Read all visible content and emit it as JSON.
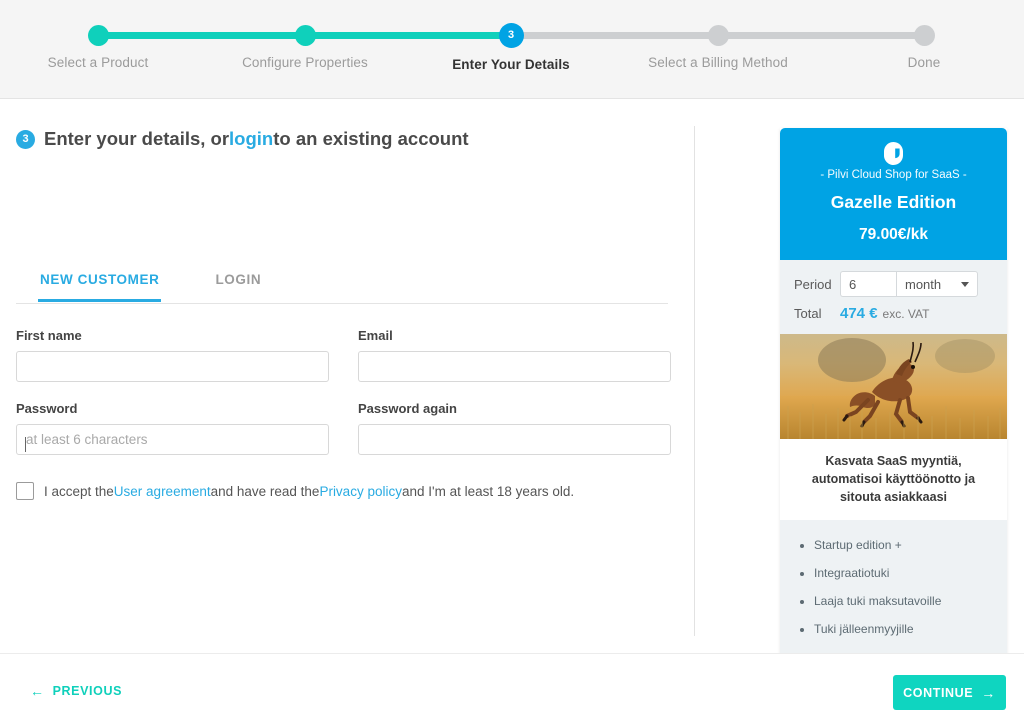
{
  "stepper": {
    "steps": [
      {
        "label": "Select a Product",
        "state": "done"
      },
      {
        "label": "Configure Properties",
        "state": "done"
      },
      {
        "label": "Enter Your Details",
        "state": "current",
        "number": "3"
      },
      {
        "label": "Select a Billing Method",
        "state": "todo"
      },
      {
        "label": "Done",
        "state": "todo"
      }
    ]
  },
  "heading": {
    "number": "3",
    "text_before": "Enter your details, or ",
    "link": "login",
    "text_after": " to an existing account"
  },
  "tabs": [
    {
      "label": "NEW CUSTOMER",
      "active": true
    },
    {
      "label": "LOGIN",
      "active": false
    }
  ],
  "form": {
    "first_name": {
      "label": "First name",
      "value": "",
      "placeholder": ""
    },
    "email": {
      "label": "Email",
      "value": "",
      "placeholder": ""
    },
    "password": {
      "label": "Password",
      "value": "",
      "placeholder": "at least 6 characters"
    },
    "password_again": {
      "label": "Password again",
      "value": "",
      "placeholder": ""
    }
  },
  "consent": {
    "text_1": "I accept the ",
    "link_1": "User agreement",
    "text_2": " and have read the ",
    "link_2": "Privacy policy",
    "text_3": " and I'm at least 18 years old.",
    "checked": false
  },
  "card": {
    "brand_tagline": "- Pilvi Cloud Shop for SaaS -",
    "title": "Gazelle Edition",
    "price": "79.00€/kk",
    "period_label": "Period",
    "period_value": "6",
    "period_unit": "month",
    "period_unit_options": [
      "month"
    ],
    "total_label": "Total",
    "total_value": "474 €",
    "total_vat_note": "exc. VAT",
    "description": "Kasvata SaaS myyntiä, automatisoi käyttöönotto ja sitouta asiakkaasi",
    "features": [
      "Startup edition +",
      "Integraatiotuki",
      "Laaja tuki maksutavoille",
      "Tuki jälleenmyyjille"
    ],
    "image_alt": "leaping gazelle in savanna grass"
  },
  "footer": {
    "previous_label": "PREVIOUS",
    "previous_icon": "arrow-left-icon",
    "continue_label": "CONTINUE",
    "continue_icon": "arrow-right-icon"
  },
  "colors": {
    "brand_blue": "#00a3e4",
    "link_blue": "#29abe2",
    "teal": "#0fd0bb",
    "gray_track": "#cdcfd1"
  }
}
